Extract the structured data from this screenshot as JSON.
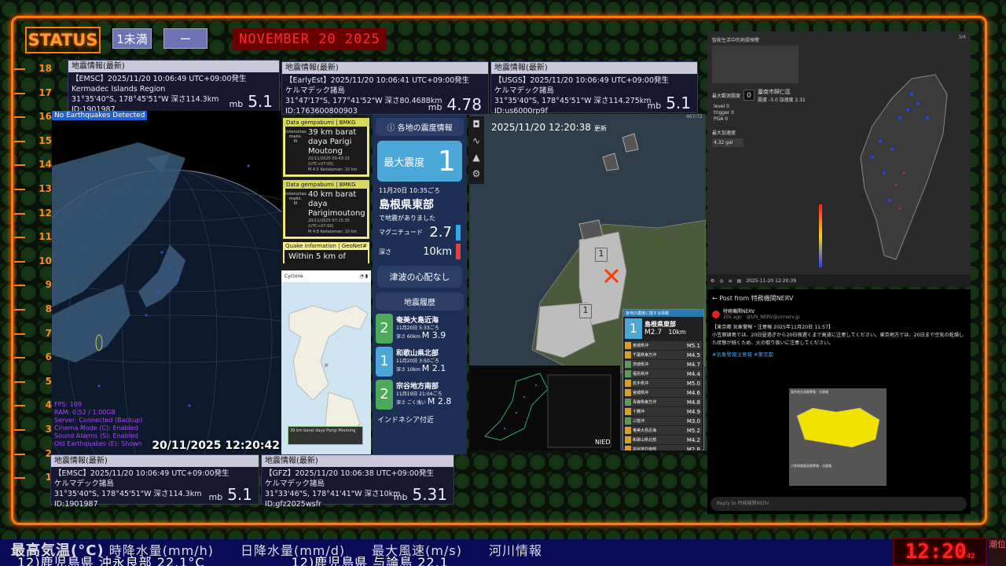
{
  "header": {
    "status_label": "STATUS",
    "chip1": "1未満",
    "chip2": "ー",
    "date": "NOVEMBER 20 2025"
  },
  "scale": [
    "18",
    "17",
    "16",
    "15",
    "14",
    "13",
    "12",
    "11",
    "10",
    "9",
    "8",
    "7",
    "6",
    "5",
    "4",
    "3",
    "2",
    "1"
  ],
  "cards": {
    "emsc_top": {
      "title": "地震情報(最新)",
      "line1": "【EMSC】2025/11/20 10:06:49 UTC+09:00発生",
      "line2": "Kermadec Islands Region",
      "line3": "31°35'40\"S, 178°45'51\"W 深さ114.3km",
      "line4": "ID:1901987",
      "mb": "mb",
      "mag": "5.1"
    },
    "earlyest": {
      "title": "地震情報(最新)",
      "line1": "【EarlyEst】2025/11/20 10:06:41 UTC+09:00発生",
      "line2": "ケルマデック諸島",
      "line3": "31°47'17\"S, 177°41'52\"W 深さ80.4688km",
      "line4": "ID:1763600800903",
      "mb": "mb",
      "mag": "4.78"
    },
    "usgs": {
      "title": "地震情報(最新)",
      "line1": "【USGS】2025/11/20 10:06:49 UTC+09:00発生",
      "line2": "ケルマデック諸島",
      "line3": "31°35'40\"S, 178°45'51\"W 深さ114.275km",
      "line4": "ID:us6000rp9f",
      "mb": "mb",
      "mag": "5.1"
    },
    "emsc_bottom": {
      "title": "地震情報(最新)",
      "line1": "【EMSC】2025/11/20 10:06:49 UTC+09:00発生",
      "line2": "ケルマデック諸島",
      "line3": "31°35'40\"S, 178°45'51\"W 深さ114.3km",
      "line4": "ID:1901987",
      "mb": "mb",
      "mag": "5.1"
    },
    "gfz": {
      "title": "地震情報(最新)",
      "line1": "【GFZ】2025/11/20 10:06:38 UTC+09:00発生",
      "line2": "ケルマデック諸島",
      "line3": "31°33'46\"S, 178°41'41\"W 深さ10km",
      "line4": "ID:gfz2025wsfr",
      "mb": "mb",
      "mag": "5.31"
    }
  },
  "globe": {
    "no_eq": "No Earthquakes Detected",
    "stats": [
      "FPS: 109",
      "RAM: 0.52 / 1.00GB",
      "Server: Connected (Backup)",
      "Cinema Mode (C): Enabled",
      "Sound Alarms (S): Enabled",
      "Old Earthquakes (E): Shown"
    ],
    "time": "20/11/2025 12:20:42"
  },
  "bmkg": [
    {
      "header": "Data gempabumi | BMKG",
      "left": "Intensitas maks.",
      "left2": "III",
      "loc": "39 km barat daya Parigi Moutong",
      "detail": "20/11/2025 09:43:13 (UTC+07:00)",
      "detail2": "M 4.5  Kedalaman: 10 km"
    },
    {
      "header": "Data gempabumi | BMKG",
      "left": "Intensitas maks.",
      "left2": "III",
      "loc": "40 km barat daya Parigimoutong",
      "detail": "20/11/2025 07:15:35 (UTC+07:00)",
      "detail2": "M 4.8  Kedalaman: 10 km"
    }
  ],
  "geonet": {
    "header": "Quake information | GeoNet",
    "text": "Within 5 km of"
  },
  "minimap": {
    "brand": "Cyclone",
    "popup": "39 km barat daya Parigi Moutong"
  },
  "jp": {
    "title": "各地の震度情報",
    "max_label": "最大震度",
    "max_value": "1",
    "time": "11月20日 10:35ごろ",
    "region": "島根県東部",
    "occurred": "で地震がありました",
    "mag_label": "マグニチュード",
    "mag_value": "2.7",
    "depth_label": "深さ",
    "depth_value": "10km",
    "tsunami": "津波の心配なし",
    "history_title": "地震履歴",
    "history": [
      {
        "scale": "2",
        "box_label": "最大震度",
        "region": "奄美大島近海",
        "time": "11月20日 5:33ごろ",
        "depth": "深さ 60km",
        "mag": "M 3.9",
        "color": "#4caa5a"
      },
      {
        "scale": "1",
        "box_label": "最大震度",
        "region": "和歌山県北部",
        "time": "11月20日 3:50ごろ",
        "depth": "深さ 10km",
        "mag": "M 2.1",
        "color": "#4aa7d8"
      },
      {
        "scale": "2",
        "box_label": "最大震度",
        "region": "宗谷地方南部",
        "time": "11月19日 21:04ごろ",
        "depth": "深さ ごく浅い",
        "mag": "M 2.8",
        "color": "#4caa5a"
      }
    ],
    "history_more": "インドネシア付近"
  },
  "map": {
    "time": "2025/11/20 12:20:38",
    "updated": "更新",
    "markers": [
      "1",
      "1"
    ],
    "count": "467/72"
  },
  "kyo": {
    "header": "各地の震度に関する情報",
    "scale": "1",
    "region": "島根県東部",
    "mag": "M2.7",
    "depth": "10km",
    "rows": [
      {
        "name": "宮城県沖",
        "mag": "M5.1"
      },
      {
        "name": "千葉県東方沖",
        "mag": "M4.5"
      },
      {
        "name": "茨城県沖",
        "mag": "M4.7"
      },
      {
        "name": "福島県沖",
        "mag": "M4.4"
      },
      {
        "name": "岩手県沖",
        "mag": "M5.0"
      },
      {
        "name": "宮城県沖",
        "mag": "M4.6"
      },
      {
        "name": "青森県東方沖",
        "mag": "M4.8"
      },
      {
        "name": "十勝沖",
        "mag": "M4.9"
      },
      {
        "name": "三陸沖",
        "mag": "M3.0"
      },
      {
        "name": "奄美大島近海",
        "mag": "M5.2"
      },
      {
        "name": "和歌山県北部",
        "mag": "M4.2"
      },
      {
        "name": "宗谷地方南部",
        "mag": "M2.8"
      }
    ]
  },
  "tw": {
    "title": "智能生活中的地震預警",
    "max_label": "最大觀測震度",
    "zero": "0",
    "place": "臺南市歸仁區",
    "values": "震度 -3.0  加速度 2.31",
    "level": "level  0",
    "trigger": "trigger  0",
    "pga": "PGA  0",
    "accel_label": "最大加速度",
    "accel": "4.32 gal",
    "foot_time": "2025-11-20 12:20:39",
    "corner": "3/4"
  },
  "xpost": {
    "header": "Post from 特務機関NERV",
    "name": "特務機関NERV",
    "handle": "20s ago · @UN_NERV@unnerv.jp",
    "body": "【東京都 気象警報・注意報 2025年11月20日 11:57】",
    "body2": "小笠原諸島では、20日昼過ぎから20日夜遅くまで高波に注意してください。東京地方では、20日まで空気の乾燥した状態が続くため、火の取り扱いに注意してください。",
    "tags": "#気象警報注意報 #東京都",
    "reply": "Reply to 特務機関NERV",
    "map_label": "東京地方気象警報・注意報",
    "map_label2": "小笠原諸島気象警報・注意報"
  },
  "ticker": {
    "line1_big": "最高気温(°C)",
    "line1_rest": "時降水量(mm/h)　　日降水量(mm/d)　　最大風速(m/s)　　河川情報",
    "line2a": "12)鹿児島県 沖永良部 22.1°C",
    "line2b": "12)鹿児島県 与論島 22.1"
  },
  "clock": {
    "time": "12:20",
    "sec": "42"
  },
  "corner": "潮位"
}
